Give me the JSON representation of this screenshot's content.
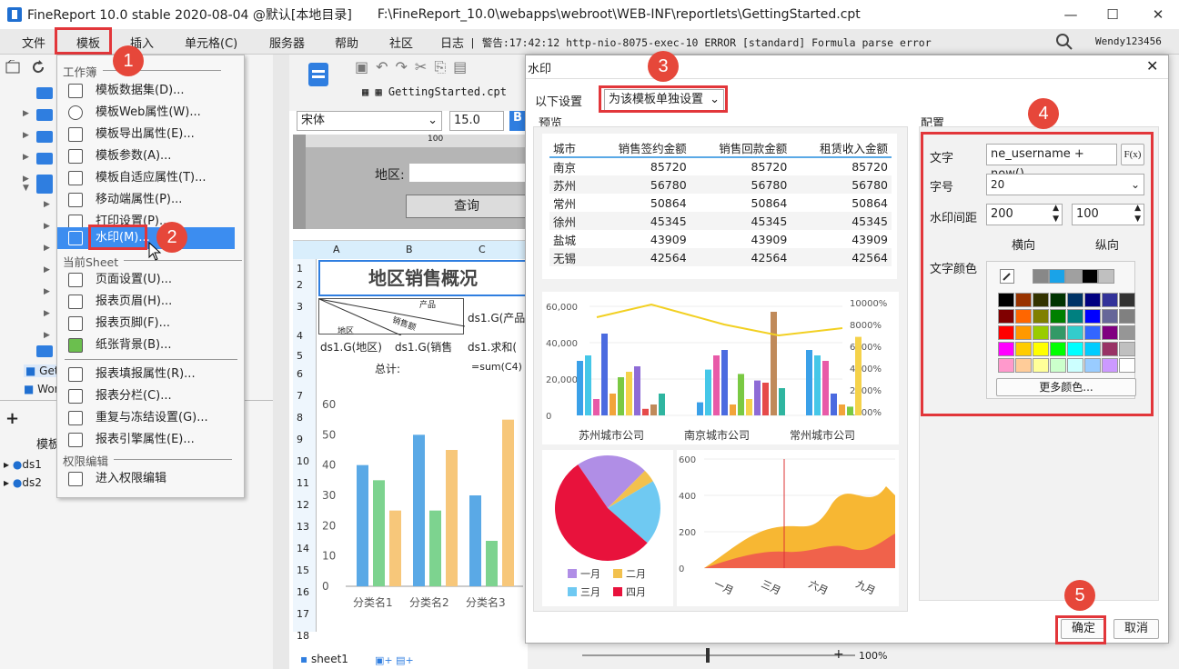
{
  "window": {
    "app_title": "FineReport 10.0 stable 2020-08-04 @默认[本地目录]",
    "file_path": "F:\\FineReport_10.0\\webapps\\webroot\\WEB-INF\\reportlets\\GettingStarted.cpt",
    "minimize": "—",
    "maximize": "☐",
    "close": "✕"
  },
  "menubar": {
    "items": [
      "文件",
      "模板",
      "插入",
      "单元格(C)",
      "服务器",
      "帮助",
      "社区",
      "日志"
    ],
    "log": "| 警告:17:42:12 http-nio-8075-exec-10 ERROR [standard] Formula parse error",
    "user": "Wendy123456"
  },
  "template_menu": {
    "section_workbook": "工作簿",
    "items_workbook": [
      "模板数据集(D)...",
      "模板Web属性(W)...",
      "模板导出属性(E)...",
      "模板参数(A)...",
      "模板自适应属性(T)...",
      "移动端属性(P)...",
      "打印设置(P)...",
      "水印(M)..."
    ],
    "section_sheet": "当前Sheet",
    "items_sheet": [
      "页面设置(U)...",
      "报表页眉(H)...",
      "报表页脚(F)...",
      "纸张背景(B)...",
      "报表填报属性(R)...",
      "报表分栏(C)...",
      "重复与冻结设置(G)...",
      "报表引擎属性(E)..."
    ],
    "section_perm": "权限编辑",
    "items_perm": [
      "进入权限编辑"
    ]
  },
  "left_panel": {
    "tree_items": [
      "Get",
      "Wor"
    ],
    "tab_label": "模板",
    "datasets": [
      "ds1",
      "ds2"
    ]
  },
  "editor": {
    "tab": "GettingStarted.cpt",
    "font": "宋体",
    "size": "15.0",
    "ruler": "100",
    "region_label": "地区:",
    "query_button": "查询",
    "columns": [
      "A",
      "B",
      "C"
    ],
    "rows": [
      "1",
      "2",
      "3",
      "4",
      "5",
      "6",
      "7",
      "8",
      "9",
      "10",
      "11",
      "12",
      "13",
      "14",
      "15",
      "16",
      "17",
      "18"
    ],
    "title_cell": "地区销售概况",
    "header_product": "产品",
    "header_sales": "销售额",
    "header_region": "地区",
    "cell_c3": "ds1.G(产品",
    "cell_a4": "ds1.G(地区)",
    "cell_b4": "ds1.G(销售",
    "cell_c4": "ds1.求和(",
    "cell_total": "总计:",
    "cell_sum": "=sum(C4)",
    "sheet_tab": "sheet1",
    "zoom": "100%",
    "mini_chart": {
      "yticks": [
        "60",
        "50",
        "40",
        "30",
        "20",
        "10",
        "0"
      ],
      "categories": [
        "分类名1",
        "分类名2",
        "分类名3"
      ],
      "series": [
        {
          "color": "#5aa9e6",
          "values": [
            40,
            50,
            30
          ]
        },
        {
          "color": "#7dd38f",
          "values": [
            35,
            25,
            15
          ]
        },
        {
          "color": "#f7c77a",
          "values": [
            25,
            45,
            55
          ]
        }
      ]
    }
  },
  "dialog": {
    "title": "水印",
    "setting_label": "以下设置",
    "setting_value": "为该模板单独设置",
    "preview_label": "预览",
    "config_label": "配置",
    "text_label": "文字",
    "text_value": "ne_username + now()",
    "formula_btn": "F(x)",
    "size_label": "字号",
    "size_value": "20",
    "gap_label": "水印间距",
    "gap_h": "200",
    "gap_v": "100",
    "horizontal": "横向",
    "vertical": "纵向",
    "color_label": "文字颜色",
    "more_colors": "更多颜色...",
    "ok": "确定",
    "cancel": "取消",
    "table_headers": [
      "城市",
      "销售签约金额",
      "销售回款金额",
      "租赁收入金额"
    ],
    "table_rows": [
      [
        "南京",
        "85720",
        "85720",
        "85720"
      ],
      [
        "苏州",
        "56780",
        "56780",
        "56780"
      ],
      [
        "常州",
        "50864",
        "50864",
        "50864"
      ],
      [
        "徐州",
        "45345",
        "45345",
        "45345"
      ],
      [
        "盐城",
        "43909",
        "43909",
        "43909"
      ],
      [
        "无锡",
        "42564",
        "42564",
        "42564"
      ]
    ],
    "bar_chart": {
      "yticks": [
        "60,000",
        "40,000",
        "20,000",
        "0"
      ],
      "y2ticks": [
        "10000%",
        "8000%",
        "6000%",
        "4000%",
        "2000%",
        "1000%"
      ],
      "categories": [
        "苏州城市公司",
        "南京城市公司",
        "常州城市公司"
      ]
    },
    "pie_legend": [
      "一月",
      "二月",
      "三月",
      "四月"
    ],
    "pie_colors": [
      "#b08ee6",
      "#f2c14e",
      "#6fc9f2",
      "#e8123c"
    ],
    "area_chart": {
      "yticks": [
        "600",
        "400",
        "200",
        "0"
      ],
      "xticks": [
        "一月",
        "三月",
        "六月",
        "九月"
      ]
    },
    "badges": [
      "1",
      "2",
      "3",
      "4",
      "5"
    ]
  },
  "palette": {
    "recent": [
      "#888888",
      "#1aa3e8",
      "#a0a0a0",
      "#000000",
      "#c0c0c0"
    ],
    "rows": [
      [
        "#000000",
        "#993300",
        "#333300",
        "#003300",
        "#003366",
        "#000080",
        "#333399",
        "#333333"
      ],
      [
        "#800000",
        "#ff6600",
        "#808000",
        "#008000",
        "#008080",
        "#0000ff",
        "#666699",
        "#808080"
      ],
      [
        "#ff0000",
        "#ff9900",
        "#99cc00",
        "#339966",
        "#33cccc",
        "#3366ff",
        "#800080",
        "#969696"
      ],
      [
        "#ff00ff",
        "#ffcc00",
        "#ffff00",
        "#00ff00",
        "#00ffff",
        "#00ccff",
        "#993366",
        "#c0c0c0"
      ],
      [
        "#ff99cc",
        "#ffcc99",
        "#ffff99",
        "#ccffcc",
        "#ccffff",
        "#99ccff",
        "#cc99ff",
        "#ffffff"
      ]
    ]
  }
}
